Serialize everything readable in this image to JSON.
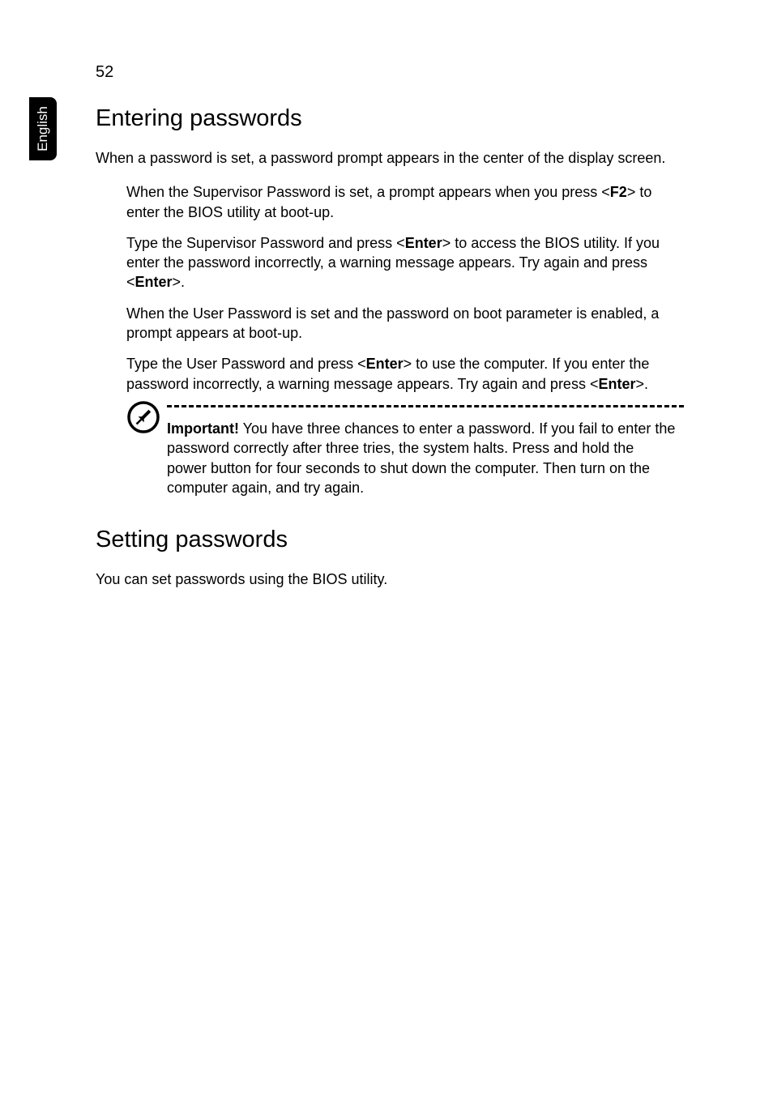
{
  "pageNumber": "52",
  "sideTab": "English",
  "heading1": "Entering passwords",
  "intro": "When a password is set, a password prompt appears in the center of the display screen.",
  "bullets": [
    {
      "pre": "When the Supervisor Password is set, a prompt appears when you press <",
      "b1": "F2",
      "mid1": "> to enter the BIOS utility at boot-up.",
      "b2": "",
      "mid2": "",
      "b3": "",
      "end": ""
    },
    {
      "pre": "Type the Supervisor Password and press <",
      "b1": "Enter",
      "mid1": "> to access the BIOS utility. If you enter the password incorrectly, a warning message appears. Try again and press <",
      "b2": "Enter",
      "mid2": ">.",
      "b3": "",
      "end": ""
    },
    {
      "pre": "When the User Password is set and the password on boot parameter is enabled, a prompt appears at boot-up.",
      "b1": "",
      "mid1": "",
      "b2": "",
      "mid2": "",
      "b3": "",
      "end": ""
    },
    {
      "pre": "Type the User Password and press <",
      "b1": "Enter",
      "mid1": "> to use the computer. If you enter the password incorrectly, a warning message appears. Try again and press <",
      "b2": "Enter",
      "mid2": ">.",
      "b3": "",
      "end": ""
    }
  ],
  "noteLabel": "Important!",
  "noteText": " You have three chances to enter a password. If you fail to enter the password correctly after three tries, the system halts. Press and hold the power button for four seconds to shut down the computer. Then turn on the computer again, and try again.",
  "heading2": "Setting passwords",
  "body2": "You can set passwords using the BIOS utility."
}
